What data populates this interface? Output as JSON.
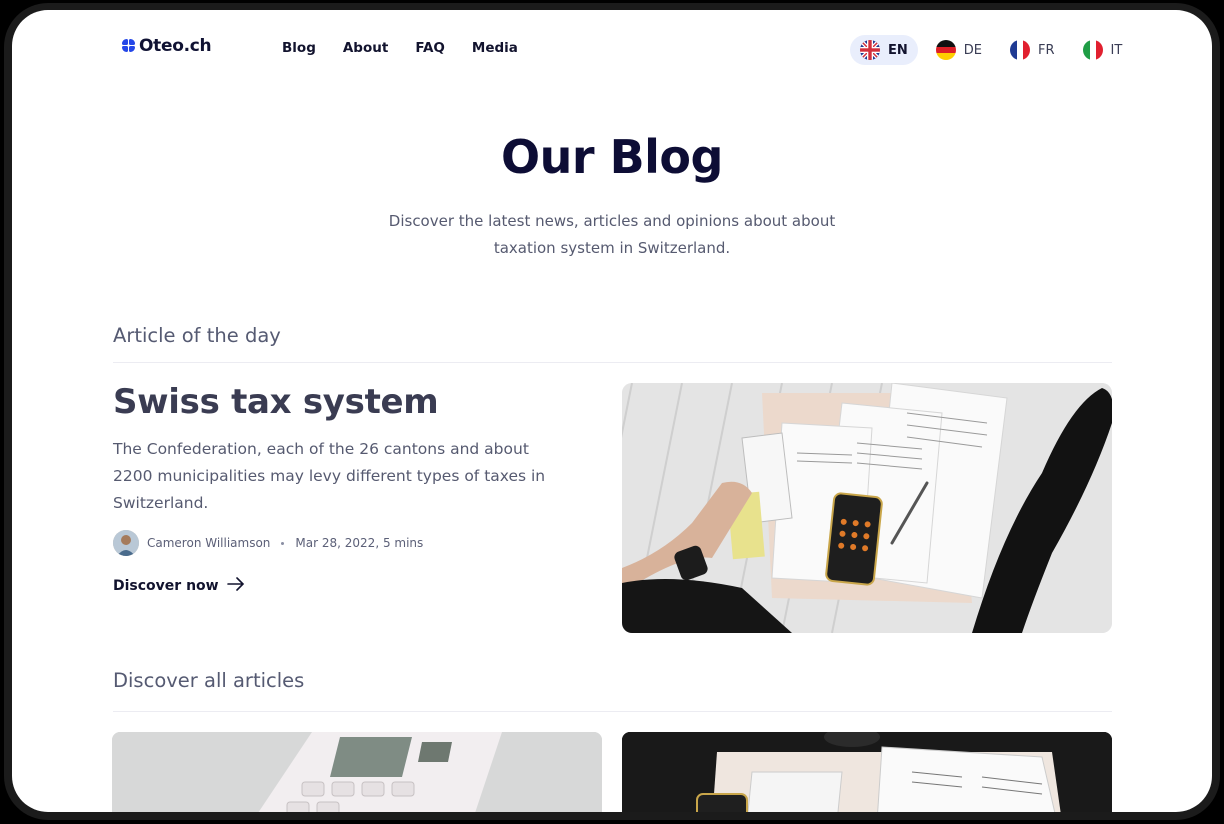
{
  "logo": {
    "text": "Oteo.ch"
  },
  "menu": [
    {
      "label": "Blog"
    },
    {
      "label": "About"
    },
    {
      "label": "FAQ"
    },
    {
      "label": "Media"
    }
  ],
  "languages": [
    {
      "code": "EN",
      "active": true
    },
    {
      "code": "DE",
      "active": false
    },
    {
      "code": "FR",
      "active": false
    },
    {
      "code": "IT",
      "active": false
    }
  ],
  "hero": {
    "title": "Our Blog",
    "subtitle": "Discover the latest news, articles and opinions about about taxation system in Switzerland."
  },
  "featured": {
    "section_label": "Article of the day",
    "title": "Swiss tax system",
    "description": "The Confederation, each of the 26 cantons and about 2200 municipalities may levy different types of taxes in Switzerland.",
    "author": "Cameron Williamson",
    "meta": "Mar 28, 2022, 5 mins",
    "cta": "Discover now"
  },
  "all_articles": {
    "section_label": "Discover all articles"
  },
  "colors": {
    "accent": "#2447e8",
    "title": "#0d0d35",
    "active_lang_bg": "#e9eefc"
  }
}
